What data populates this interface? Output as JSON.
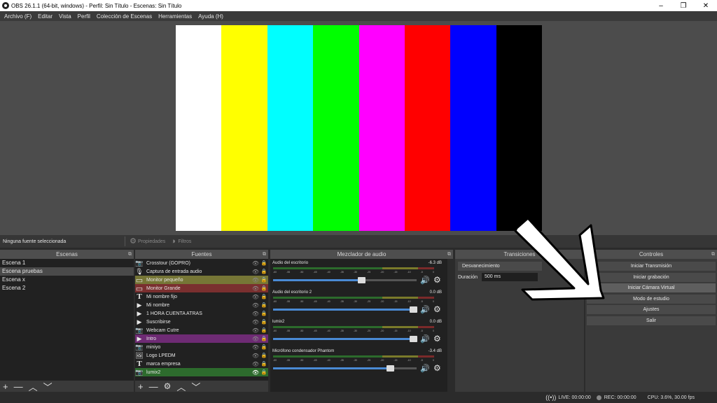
{
  "window": {
    "title": "OBS 26.1.1 (64-bit, windows) - Perfil: Sin Título - Escenas: Sin Título",
    "minimize_icon": "–",
    "maximize_icon": "❐",
    "close_icon": "✕"
  },
  "menu": [
    "Archivo (F)",
    "Editar",
    "Vista",
    "Perfil",
    "Colección de Escenas",
    "Herramientas",
    "Ayuda (H)"
  ],
  "preview": {
    "bar_colors": [
      "#ffffff",
      "#ffff00",
      "#00ffff",
      "#00ff00",
      "#ff00ff",
      "#ff0000",
      "#0000ff",
      "#000000"
    ]
  },
  "source_toolbar": {
    "no_source": "Ninguna fuente seleccionada",
    "properties": "Propiedades",
    "filters": "Filtros"
  },
  "scenes": {
    "title": "Escenas",
    "items": [
      "Escena 1",
      "Escena pruebas",
      "Escena x",
      "Escena 2"
    ],
    "selected_index": 1
  },
  "sources": {
    "title": "Fuentes",
    "items": [
      {
        "name": "Crosstour (GOPRO)",
        "icon": "camera-icon",
        "highlight": ""
      },
      {
        "name": "Captura de entrada audio",
        "icon": "microphone-icon",
        "highlight": ""
      },
      {
        "name": "Monitor pequeño",
        "icon": "monitor-icon",
        "highlight": "#767636"
      },
      {
        "name": "Monitor Grande",
        "icon": "monitor-icon",
        "highlight": "#7a2f2f"
      },
      {
        "name": "Mi nombre fijo",
        "icon": "text-icon",
        "highlight": ""
      },
      {
        "name": "Mi nombre",
        "icon": "play-icon",
        "highlight": ""
      },
      {
        "name": "1 HORA CUENTA ATRAS",
        "icon": "play-icon",
        "highlight": ""
      },
      {
        "name": "Suscribirse",
        "icon": "play-icon",
        "highlight": ""
      },
      {
        "name": "Webcam Cutre",
        "icon": "camera-icon",
        "highlight": ""
      },
      {
        "name": "Intro",
        "icon": "play-icon",
        "highlight": "#6e2b74"
      },
      {
        "name": "miniyo",
        "icon": "camera-icon",
        "highlight": ""
      },
      {
        "name": "Logo LPEDM",
        "icon": "image-icon",
        "highlight": ""
      },
      {
        "name": "marca empresa",
        "icon": "text-icon",
        "highlight": ""
      },
      {
        "name": "lumix2",
        "icon": "camera-icon",
        "highlight": "#2d6b2d"
      }
    ]
  },
  "mixer": {
    "title": "Mezclador de audio",
    "ticks": [
      "-60",
      "-55",
      "-50",
      "-45",
      "-40",
      "-35",
      "-30",
      "-25",
      "-20",
      "-15",
      "-10",
      "-5",
      "0"
    ],
    "channels": [
      {
        "name": "Audio del escritorio",
        "db": "-6.3 dB",
        "level": 0.62
      },
      {
        "name": "Audio del escritorio 2",
        "db": "0.0 dB",
        "level": 0.98
      },
      {
        "name": "lumix2",
        "db": "0.0 dB",
        "level": 0.98
      },
      {
        "name": "Micrófono condensador Phantom",
        "db": "-3.4 dB",
        "level": 0.82
      }
    ]
  },
  "transitions": {
    "title": "Transiciones",
    "type": "Desvanecimiento",
    "duration_label": "Duración",
    "duration_value": "500 ms"
  },
  "controls": {
    "title": "Controles",
    "buttons": [
      "Iniciar Transmisión",
      "Iniciar grabación",
      "Iniciar Cámara Virtual",
      "Modo de estudio",
      "Ajustes",
      "Salir"
    ],
    "highlighted_index": 2
  },
  "status": {
    "live": "LIVE: 00:00:00",
    "rec": "REC: 00:00:00",
    "cpu": "CPU: 3.6%, 30.00 fps"
  }
}
